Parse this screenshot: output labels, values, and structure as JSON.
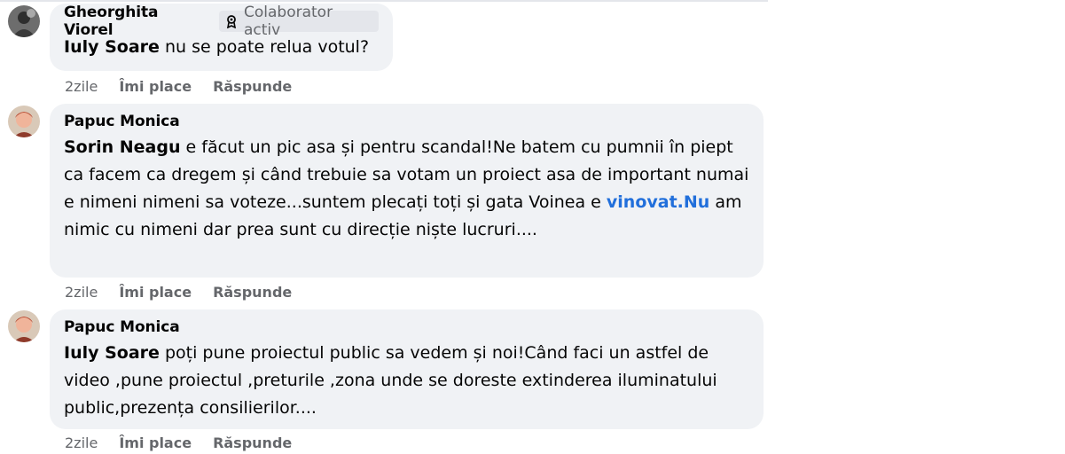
{
  "comments": [
    {
      "author": "Gheorghita Viorel",
      "badge": "Colaborator activ",
      "badge_icon": "contributor-badge-icon",
      "mention": "Iuly Soare",
      "text": " nu se poate relua votul?",
      "time": "2zile",
      "like": "Îmi place",
      "reply": "Răspunde"
    },
    {
      "author": "Papuc Monica",
      "mention": "Sorin Neagu",
      "text_before_link": " e făcut un pic asa și pentru scandal!Ne batem cu pumnii în piept ca facem ca dregem și când trebuie sa votam un proiect asa de important numai e nimeni nimeni sa voteze...suntem plecați toți și gata Voinea e ",
      "link": "vinovat.Nu",
      "text_after_link": " am nimic cu nimeni dar prea sunt cu direcție niște lucruri....",
      "time": "2zile",
      "like": "Îmi place",
      "reply": "Răspunde"
    },
    {
      "author": "Papuc Monica",
      "mention": "Iuly Soare",
      "text": " poți pune proiectul public sa vedem și noi!Când faci un astfel de video ,pune proiectul ,preturile ,zona unde se doreste extinderea iluminatului public,prezența consilierilor....",
      "time": "2zile",
      "like": "Îmi place",
      "reply": "Răspunde"
    }
  ],
  "colors": {
    "bubble": "#f0f2f5",
    "secondary_text": "#65676b",
    "link": "#216fdb"
  }
}
